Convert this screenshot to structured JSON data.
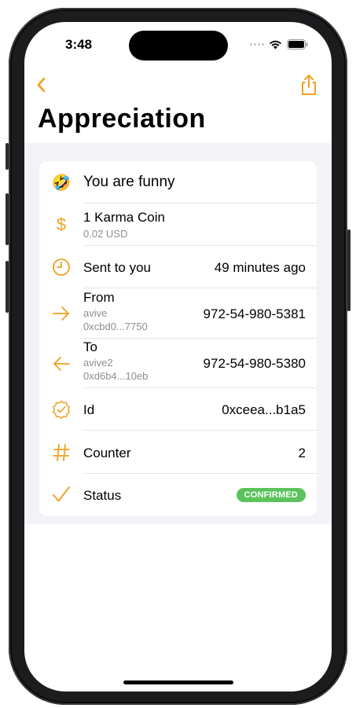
{
  "status_bar": {
    "time": "3:48"
  },
  "nav": {
    "title": "Appreciation"
  },
  "rows": {
    "message": {
      "emoji": "🤣",
      "text": "You are funny"
    },
    "amount": {
      "label": "1 Karma Coin",
      "sub": "0.02 USD"
    },
    "sent": {
      "label": "Sent to you",
      "value": "49 minutes ago"
    },
    "from": {
      "label": "From",
      "name": "avive",
      "address": "0xcbd0...7750",
      "value": "972-54-980-5381"
    },
    "to": {
      "label": "To",
      "name": "avive2",
      "address": "0xd6b4...10eb",
      "value": "972-54-980-5380"
    },
    "id": {
      "label": "Id",
      "value": "0xceea...b1a5"
    },
    "counter": {
      "label": "Counter",
      "value": "2"
    },
    "status": {
      "label": "Status",
      "badge": "CONFIRMED"
    }
  },
  "colors": {
    "accent": "#f0a020",
    "badge": "#5cc35c",
    "background": "#f2f2f7"
  },
  "icons": [
    "chevron-left-icon",
    "share-icon",
    "dollar-icon",
    "clock-icon",
    "arrow-right-icon",
    "arrow-left-icon",
    "verified-badge-icon",
    "hash-icon",
    "checkmark-icon"
  ]
}
